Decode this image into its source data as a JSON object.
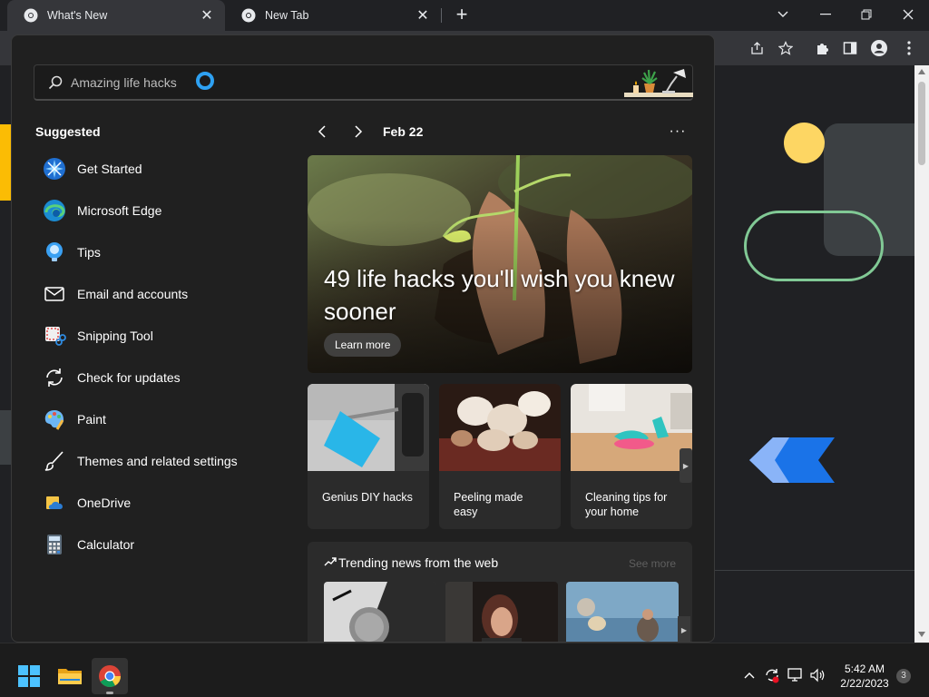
{
  "browser": {
    "tabs": [
      {
        "title": "What's New",
        "active": true
      },
      {
        "title": "New Tab",
        "active": false
      }
    ]
  },
  "start_menu": {
    "search": {
      "value": "",
      "placeholder": "Amazing life hacks"
    },
    "suggested_title": "Suggested",
    "suggested": [
      {
        "label": "Get Started",
        "icon": "get-started-icon"
      },
      {
        "label": "Microsoft Edge",
        "icon": "edge-icon"
      },
      {
        "label": "Tips",
        "icon": "tips-icon"
      },
      {
        "label": "Email and accounts",
        "icon": "mail-icon"
      },
      {
        "label": "Snipping Tool",
        "icon": "snipping-tool-icon"
      },
      {
        "label": "Check for updates",
        "icon": "update-icon"
      },
      {
        "label": "Paint",
        "icon": "paint-icon"
      },
      {
        "label": "Themes and related settings",
        "icon": "brush-icon"
      },
      {
        "label": "OneDrive",
        "icon": "onedrive-icon"
      },
      {
        "label": "Calculator",
        "icon": "calculator-icon"
      }
    ],
    "nav": {
      "date": "Feb 22",
      "more": "···"
    },
    "hero": {
      "title": "49 life hacks you'll wish you knew sooner",
      "button": "Learn more"
    },
    "cards": [
      {
        "caption": "Genius DIY hacks"
      },
      {
        "caption": "Peeling made easy"
      },
      {
        "caption": "Cleaning tips for your home"
      }
    ],
    "trending": {
      "title": "Trending news from the web",
      "see_more": "See more"
    }
  },
  "taskbar": {
    "time": "5:42 AM",
    "date": "2/22/2023",
    "notification_count": "3"
  }
}
